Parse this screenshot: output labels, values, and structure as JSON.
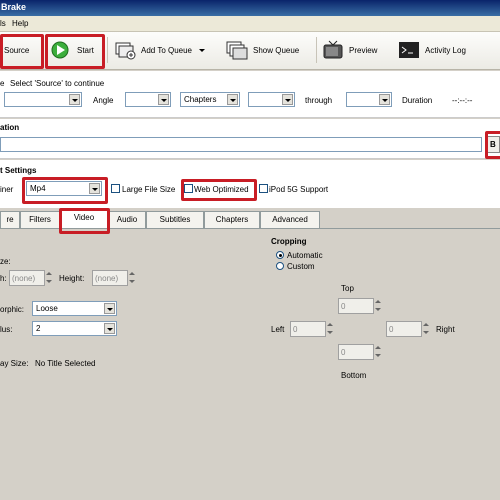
{
  "window": {
    "title": "Brake"
  },
  "menu": {
    "items": [
      "ls",
      "Help"
    ]
  },
  "toolbar": {
    "source": "Source",
    "start": "Start",
    "add_to_queue": "Add To Queue",
    "show_queue": "Show Queue",
    "preview": "Preview",
    "activity_log": "Activity Log"
  },
  "source_row": {
    "prefix": "e",
    "hint": "Select 'Source' to continue",
    "angle_label": "Angle",
    "chapters_value": "Chapters",
    "through_label": "through",
    "duration_label": "Duration",
    "duration_value": "--:--:--"
  },
  "destination": {
    "heading": "ation",
    "browse_label": "B"
  },
  "output_settings": {
    "heading": "t Settings",
    "container_label": "iner",
    "container_value": "Mp4",
    "large_file_size": "Large File Size",
    "web_optimized": "Web Optimized",
    "ipod_support": "iPod 5G Support"
  },
  "tabs": [
    "re",
    "Filters",
    "Video",
    "Audio",
    "Subtitles",
    "Chapters",
    "Advanced"
  ],
  "picture": {
    "size_label": "ze:",
    "width_label": "h:",
    "width_value": "(none)",
    "height_label": "Height:",
    "height_value": "(none)",
    "anamorphic_label": "orphic:",
    "anamorphic_value": "Loose",
    "modulus_label": "lus:",
    "modulus_value": "2",
    "display_size_label": "ay Size:",
    "display_size_value": "No Title Selected"
  },
  "cropping": {
    "heading": "Cropping",
    "automatic": "Automatic",
    "custom": "Custom",
    "top_label": "Top",
    "left_label": "Left",
    "right_label": "Right",
    "bottom_label": "Bottom",
    "top_value": "0",
    "left_value": "0",
    "right_value": "0",
    "bottom_value": "0"
  },
  "colors": {
    "highlight": "#c81d25"
  }
}
